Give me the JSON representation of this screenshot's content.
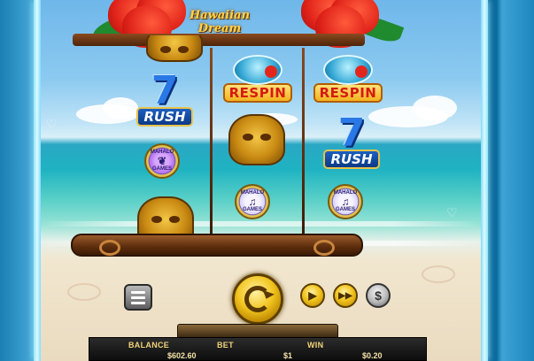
{
  "game": {
    "title_line1": "Hawaiian",
    "title_line2": "Dream"
  },
  "reels": [
    {
      "symbols": [
        {
          "type": "mask",
          "name": "tiki-mask"
        },
        {
          "type": "seven",
          "num": "7",
          "label": "RUSH"
        },
        {
          "type": "coin",
          "line1": "MAHALO",
          "line2": "GAMES",
          "variant": "purple"
        },
        {
          "type": "mask",
          "name": "tiki-mask"
        }
      ]
    },
    {
      "symbols": [
        {
          "type": "respin",
          "label": "RESPIN"
        },
        {
          "type": "mask",
          "name": "tiki-mask"
        },
        {
          "type": "coin",
          "line1": "MAHALO",
          "line2": "GAMES",
          "variant": "white"
        }
      ]
    },
    {
      "symbols": [
        {
          "type": "respin",
          "label": "RESPIN"
        },
        {
          "type": "seven",
          "num": "7",
          "label": "RUSH"
        },
        {
          "type": "coin",
          "line1": "MAHALO",
          "line2": "GAMES",
          "variant": "white"
        }
      ]
    }
  ],
  "controls": {
    "menu_icon": "hamburger-menu-icon",
    "spin_icon": "spin-arrows-icon",
    "play_icon": "▶",
    "fast_forward_icon": "▶▶",
    "coin_icon": "$"
  },
  "info_bar": {
    "balance_label": "BALANCE",
    "balance_value": "$602.60",
    "bet_label": "BET",
    "bet_value": "$1",
    "win_label": "WIN",
    "win_value": "$0.20"
  },
  "colors": {
    "accent_gold": "#f2c51e",
    "frame_wood": "#5b2c0c",
    "hibiscus_red": "#e0231a",
    "sky_blue": "#6fb7ea"
  }
}
